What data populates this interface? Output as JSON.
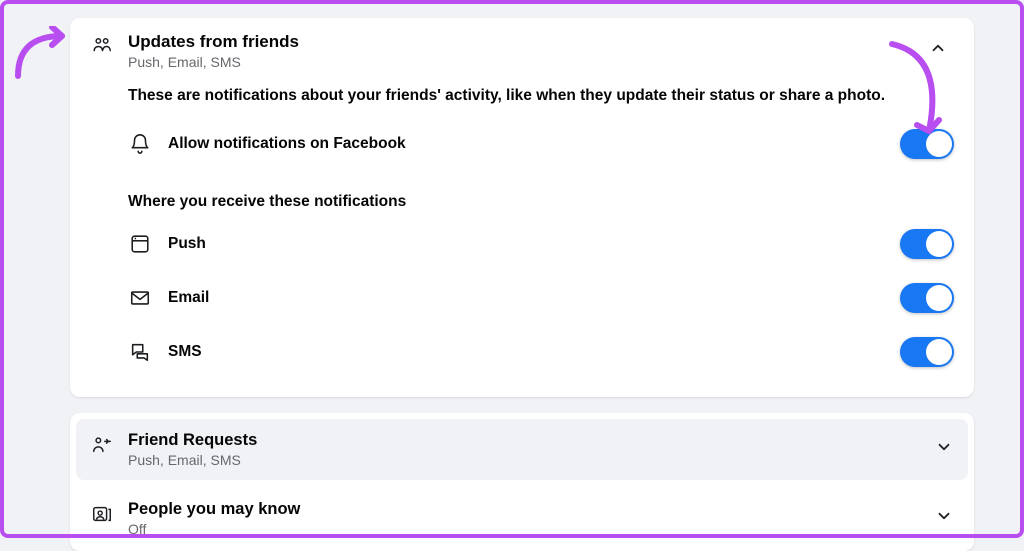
{
  "colors": {
    "accent": "#1877f2",
    "annotation": "#b84ef0"
  },
  "updates": {
    "title": "Updates from friends",
    "subtitle": "Push, Email, SMS",
    "description": "These are notifications about your friends' activity, like when they update their status or share a photo.",
    "allow_label": "Allow notifications on Facebook",
    "allow_on": true,
    "where_heading": "Where you receive these notifications",
    "channels": [
      {
        "key": "push",
        "label": "Push",
        "icon": "app-window-icon",
        "on": true
      },
      {
        "key": "email",
        "label": "Email",
        "icon": "envelope-icon",
        "on": true
      },
      {
        "key": "sms",
        "label": "SMS",
        "icon": "chat-bubbles-icon",
        "on": true
      }
    ]
  },
  "collapsed": [
    {
      "key": "friend_requests",
      "title": "Friend Requests",
      "subtitle": "Push, Email, SMS",
      "icon": "friend-request-icon",
      "highlight": true
    },
    {
      "key": "pymk",
      "title": "People you may know",
      "subtitle": "Off",
      "icon": "people-card-icon",
      "highlight": false
    }
  ]
}
